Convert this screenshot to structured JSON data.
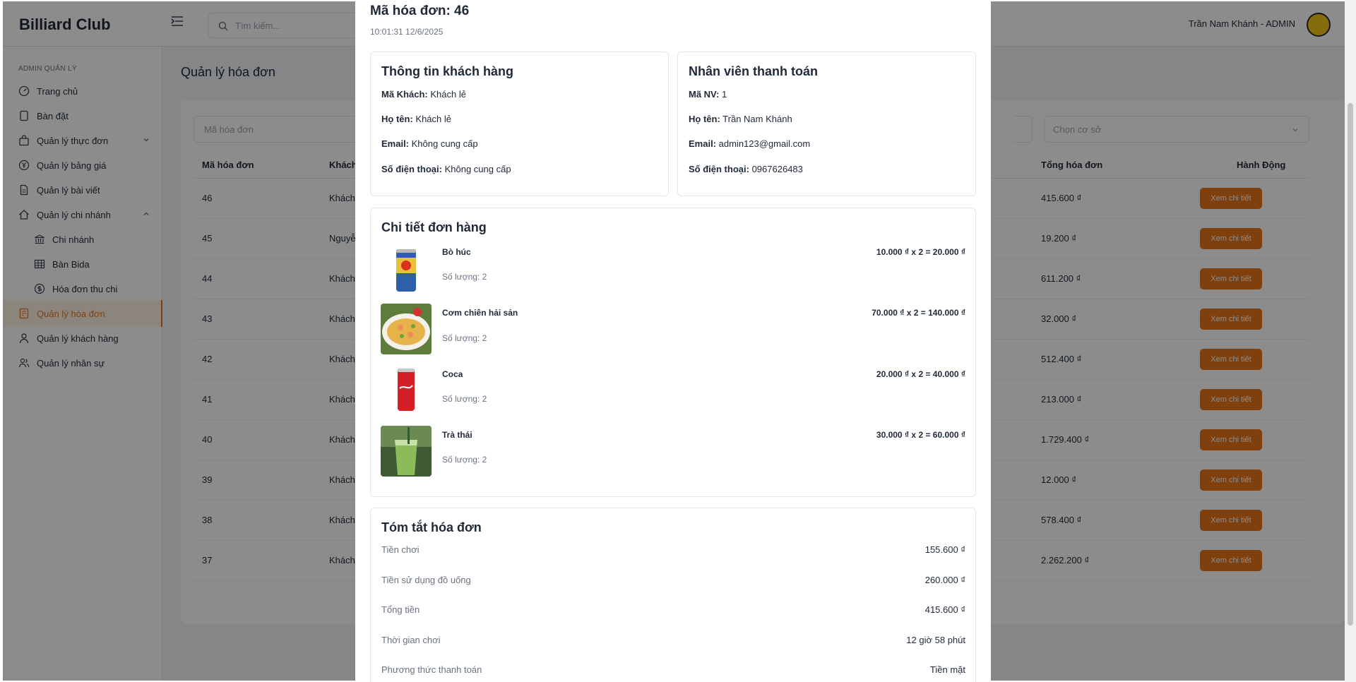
{
  "app": {
    "brand": "Billiard Club",
    "search_placeholder": "Tìm kiếm...",
    "user": "Trần Nam Khánh - ADMIN"
  },
  "sidebar": {
    "section": "ADMIN QUẢN LÝ",
    "items": [
      {
        "label": "Trang chủ",
        "icon": "gauge-icon"
      },
      {
        "label": "Bàn đặt",
        "icon": "tablet-icon"
      },
      {
        "label": "Quản lý thực đơn",
        "icon": "bag-icon"
      },
      {
        "label": "Quản lý bảng giá",
        "icon": "yen-circle-icon"
      },
      {
        "label": "Quản lý bài viết",
        "icon": "document-icon"
      },
      {
        "label": "Quản lý chi nhánh",
        "icon": "home-icon"
      },
      {
        "label": "Chi nhánh",
        "icon": "bank-icon"
      },
      {
        "label": "Bàn Bida",
        "icon": "table-grid-icon"
      },
      {
        "label": "Hóa đơn thu chi",
        "icon": "dollar-circle-icon"
      },
      {
        "label": "Quản lý hóa đơn",
        "icon": "receipt-icon"
      },
      {
        "label": "Quản lý khách hàng",
        "icon": "user-icon"
      },
      {
        "label": "Quản lý nhân sự",
        "icon": "users-icon"
      }
    ]
  },
  "page": {
    "title": "Quản lý hóa đơn",
    "filter_placeholder": "Mã hóa đơn",
    "branch_placeholder": "Chọn cơ sở",
    "columns": {
      "id": "Mã hóa đơn",
      "customer": "Khách",
      "total": "Tổng hóa đơn",
      "action": "Hành Động"
    },
    "action_label": "Xem chi tiết",
    "rows": [
      {
        "id": "46",
        "customer": "Khách",
        "total": "415.600 ₫"
      },
      {
        "id": "45",
        "customer": "Nguyễn",
        "total": "19.200 ₫"
      },
      {
        "id": "44",
        "customer": "Khách",
        "total": "611.200 ₫"
      },
      {
        "id": "43",
        "customer": "Khách",
        "total": "32.000 ₫"
      },
      {
        "id": "42",
        "customer": "Khách",
        "total": "512.400 ₫"
      },
      {
        "id": "41",
        "customer": "Khách",
        "total": "213.000 ₫"
      },
      {
        "id": "40",
        "customer": "Khách",
        "total": "1.729.400 ₫"
      },
      {
        "id": "39",
        "customer": "Khách",
        "total": "12.000 ₫"
      },
      {
        "id": "38",
        "customer": "Khách",
        "total": "578.400 ₫"
      },
      {
        "id": "37",
        "customer": "Khách",
        "total": "2.262.200 ₫"
      }
    ]
  },
  "modal": {
    "title": "Mã hóa đơn: 46",
    "time": "10:01:31 12/6/2025",
    "customer": {
      "heading": "Thông tin khách hàng",
      "fields": [
        {
          "label": "Mã Khách:",
          "value": "Khách lẻ"
        },
        {
          "label": "Họ tên:",
          "value": "Khách lẻ"
        },
        {
          "label": "Email:",
          "value": "Không cung cấp"
        },
        {
          "label": "Số điện thoại:",
          "value": "Không cung cấp"
        }
      ]
    },
    "staff": {
      "heading": "Nhân viên thanh toán",
      "fields": [
        {
          "label": "Mã NV:",
          "value": "1"
        },
        {
          "label": "Họ tên:",
          "value": "Trần Nam Khánh"
        },
        {
          "label": "Email:",
          "value": "admin123@gmail.com"
        },
        {
          "label": "Số điện thoại:",
          "value": "0967626483"
        }
      ]
    },
    "details": {
      "heading": "Chi tiết đơn hàng",
      "items": [
        {
          "name": "Bò húc",
          "qty": "Số lượng: 2",
          "price": "10.000 ₫ x 2 = 20.000 ₫",
          "image": "energy-drink-can"
        },
        {
          "name": "Cơm chiên hải sản",
          "qty": "Số lượng: 2",
          "price": "70.000 ₫ x 2 = 140.000 ₫",
          "image": "fried-rice-plate"
        },
        {
          "name": "Coca",
          "qty": "Số lượng: 2",
          "price": "20.000 ₫ x 2 = 40.000 ₫",
          "image": "cola-can"
        },
        {
          "name": "Trà thái",
          "qty": "Số lượng: 2",
          "price": "30.000 ₫ x 2 = 60.000 ₫",
          "image": "green-tea-glass"
        }
      ]
    },
    "summary": {
      "heading": "Tóm tắt hóa đơn",
      "rows": [
        {
          "label": "Tiền chơi",
          "value": "155.600 ₫"
        },
        {
          "label": "Tiền sử dụng đồ uống",
          "value": "260.000 ₫"
        },
        {
          "label": "Tổng tiền",
          "value": "415.600 ₫"
        },
        {
          "label": "Thời gian chơi",
          "value": "12 giờ 58 phút"
        },
        {
          "label": "Phương thức thanh toán",
          "value": "Tiền mặt"
        }
      ]
    }
  },
  "colors": {
    "accent": "#e8761a",
    "overlay": "rgba(0,0,0,0.45)"
  }
}
